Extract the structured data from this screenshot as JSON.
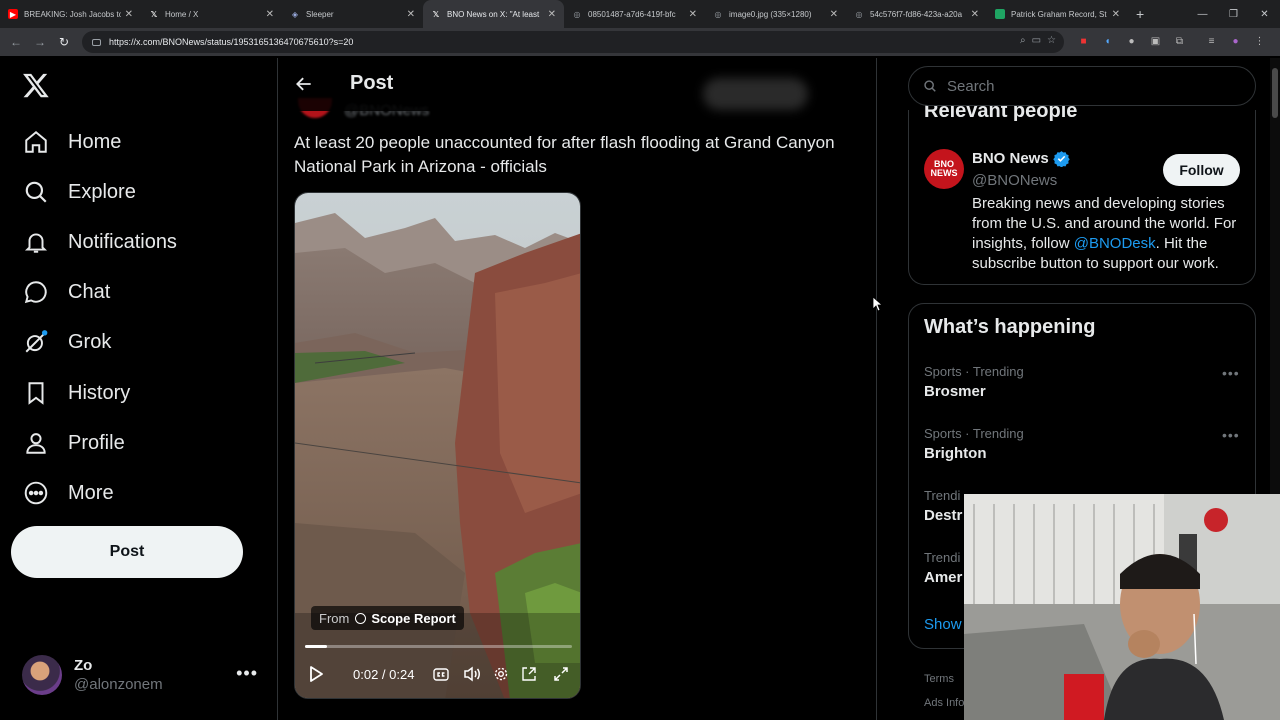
{
  "browser": {
    "tabs": [
      {
        "title": "BREAKING: Josh Jacobs to",
        "icon": "youtube-icon",
        "color": "#ff0000"
      },
      {
        "title": "Home / X",
        "icon": "x-icon",
        "color": "#ffffff"
      },
      {
        "title": "Sleeper",
        "icon": "sleeper-icon",
        "color": "#1f8ce6"
      },
      {
        "title": "BNO News on X: \"At least",
        "icon": "x-icon",
        "color": "#ffffff",
        "active": true
      },
      {
        "title": "08501487-a7d6-419f-bfc",
        "icon": "globe-icon",
        "color": "#9aa0a6"
      },
      {
        "title": "image0.jpg (335×1280)",
        "icon": "globe-icon",
        "color": "#9aa0a6"
      },
      {
        "title": "54c576f7-fd86-423a-a20a",
        "icon": "globe-icon",
        "color": "#9aa0a6"
      },
      {
        "title": "Patrick Graham Record, St",
        "icon": "sheets-icon",
        "color": "#1fa463"
      }
    ],
    "url": "https://x.com/BNONews/status/1953165136470675610?s=20"
  },
  "sidebar": {
    "items": [
      {
        "label": "Home",
        "icon": "home-icon"
      },
      {
        "label": "Explore",
        "icon": "search-icon"
      },
      {
        "label": "Notifications",
        "icon": "bell-icon"
      },
      {
        "label": "Chat",
        "icon": "chat-bubble-icon"
      },
      {
        "label": "Grok",
        "icon": "grok-icon"
      },
      {
        "label": "History",
        "icon": "bookmark-icon"
      },
      {
        "label": "Profile",
        "icon": "person-icon"
      },
      {
        "label": "More",
        "icon": "more-circle-icon"
      }
    ],
    "post_button": "Post",
    "account": {
      "name": "Zo",
      "handle": "@alonzonem"
    }
  },
  "main": {
    "header_title": "Post",
    "peek_handle": "@BNONews",
    "tweet_text": "At least 20 people unaccounted for after flash flooding at Grand Canyon National Park in Arizona - officials",
    "video": {
      "from_label": "From",
      "source": "Scope Report",
      "time": "0:02 / 0:24",
      "progress": 0.083
    }
  },
  "right": {
    "search_placeholder": "Search",
    "relevant_title": "Relevant people",
    "account": {
      "name": "BNO News",
      "handle": "@BNONews",
      "avatar_text_1": "BNO",
      "avatar_text_2": "NEWS",
      "follow": "Follow",
      "bio_1": "Breaking news and developing stories from the U.S. and around the world. For insights, follow ",
      "bio_mention": "@BNODesk",
      "bio_2": ". Hit the subscribe button to support our work."
    },
    "happening_title": "What’s happening",
    "trends": [
      {
        "meta": "Sports · Trending",
        "name": "Brosmer"
      },
      {
        "meta": "Sports · Trending",
        "name": "Brighton"
      },
      {
        "meta": "Trendi",
        "name": "Destr"
      },
      {
        "meta": "Trendi",
        "name": "Amer"
      }
    ],
    "show_more": "Show",
    "footer_1": "Terms",
    "footer_2": "Ads Info"
  },
  "colors": {
    "accent": "#1d9bf0",
    "background": "#000000",
    "border": "#2f3336",
    "muted": "#71767b"
  }
}
